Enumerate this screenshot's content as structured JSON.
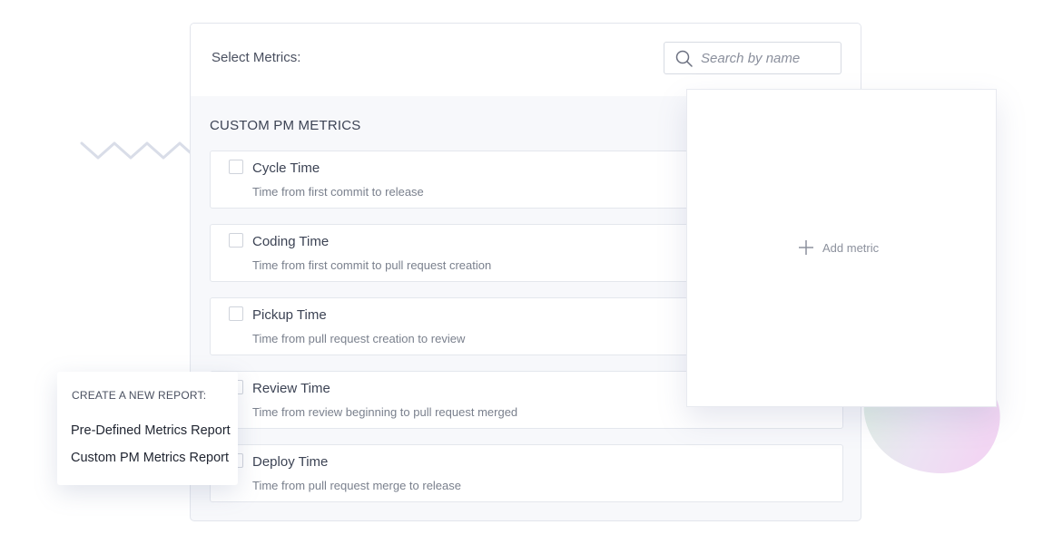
{
  "header": {
    "select_label": "Select Metrics:",
    "search_placeholder": "Search by name"
  },
  "section": {
    "title": "CUSTOM PM METRICS"
  },
  "metrics": [
    {
      "name": "Cycle Time",
      "description": "Time from first commit to release",
      "checked": false
    },
    {
      "name": "Coding Time",
      "description": "Time from first commit to pull request creation",
      "checked": false
    },
    {
      "name": "Pickup Time",
      "description": "Time from pull request creation to review",
      "checked": false
    },
    {
      "name": "Review Time",
      "description": "Time from review beginning to pull request merged",
      "checked": false
    },
    {
      "name": "Deploy Time",
      "description": "Time from pull request merge to release",
      "checked": false
    }
  ],
  "add_card": {
    "label": "Add metric"
  },
  "report_menu": {
    "title": "CREATE A NEW REPORT:",
    "options": [
      "Pre-Defined Metrics Report",
      "Custom PM Metrics Report"
    ]
  },
  "colors": {
    "border": "#e4e7ed",
    "panel_background": "#f7f8fb",
    "text": "#3c4354",
    "muted_text": "#7a808d",
    "zigzag": "#d9dde8"
  }
}
